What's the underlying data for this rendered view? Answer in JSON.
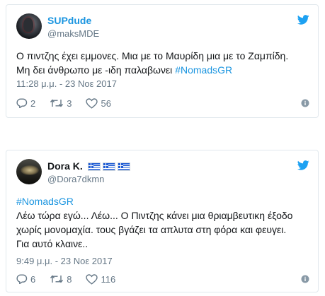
{
  "tweets": [
    {
      "display_name": "SUPdude",
      "handle": "@maksMDE",
      "text_line1": "Ο πιντζης έχει εμμονες. Μια με το Μαυρίδη μια με το Ζαμπίδη.",
      "text_line2_plain": "Μη δει άνθρωπο με -ιδη παλαβωνει ",
      "text_line2_hashtag": "#NomadsGR",
      "timestamp": "11:28 μ.μ. - 23 Νοε 2017",
      "replies": "2",
      "retweets": "3",
      "likes": "56"
    },
    {
      "display_name": "Dora K.",
      "handle": "@Dora7dkmn",
      "hashtag_line": "#NomadsGR",
      "text_line1": "Λέω τώρα εγώ... Λέω... Ο Πιντζης κάνει μια θριαμβευτικη έξοδο",
      "text_line2": "χωρίς μονομαχία. τους βγάζει τα απλυτα στη φόρα και φευγει.",
      "text_line3": "Για αυτό κλαινε..",
      "timestamp": "9:49 μ.μ. - 23 Νοε 2017",
      "replies": "6",
      "retweets": "8",
      "likes": "116"
    }
  ],
  "icons": {
    "twitter": "twitter-bird-icon",
    "reply": "reply-icon",
    "retweet": "retweet-icon",
    "like": "heart-icon",
    "info": "info-icon",
    "flag": "greece-flag-icon"
  },
  "colors": {
    "link": "#1b95e0",
    "muted": "#657786",
    "text": "#14171a",
    "border": "#e1e8ed"
  }
}
